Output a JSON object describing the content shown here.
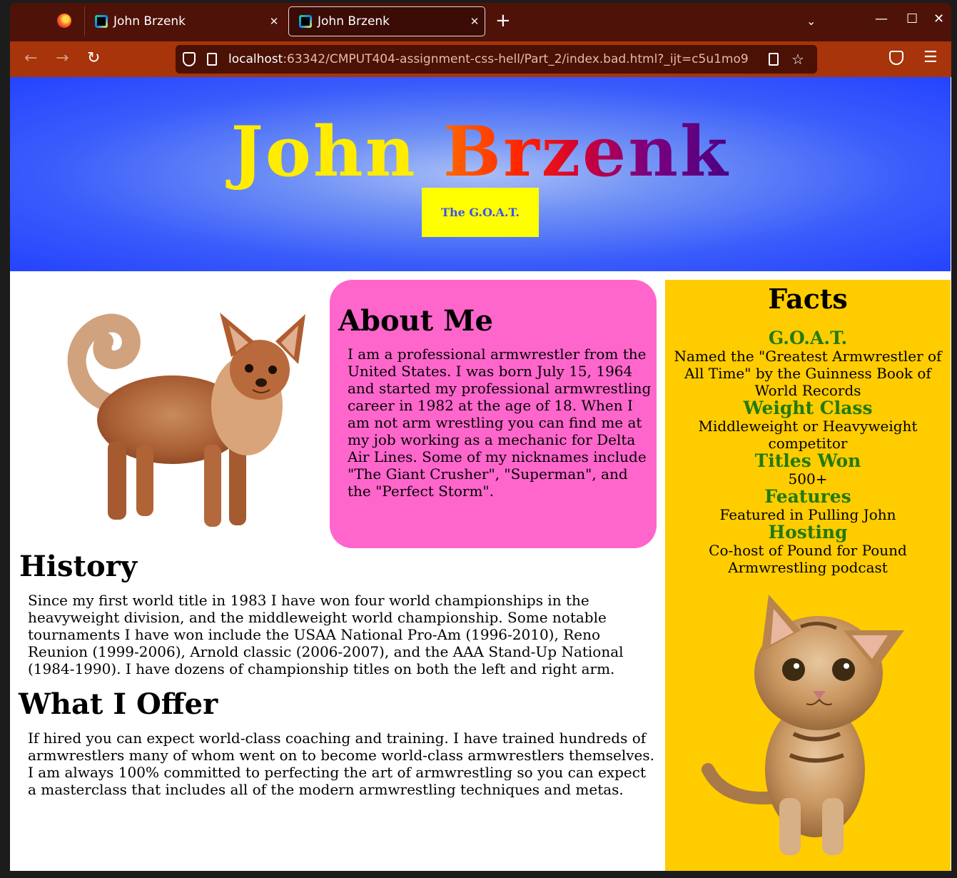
{
  "browser": {
    "tabs": [
      {
        "title": "John Brzenk"
      },
      {
        "title": "John Brzenk"
      }
    ],
    "new_tab_label": "+",
    "url_host": "localhost",
    "url_rest": ":63342/CMPUT404-assignment-css-hell/Part_2/index.bad.html?_ijt=c5u1mo9"
  },
  "page": {
    "hero": {
      "first_name": "John",
      "last_name": "Brzenk",
      "badge": "The G.O.A.T."
    },
    "about": {
      "title": "About Me",
      "text": "I am a professional armwrestler from the United States. I was born July 15, 1964 and started my professional armwrestling career in 1982 at the age of 18. When I am not arm wrestling you can find me at my job working as a mechanic for Delta Air Lines. Some of my nicknames include \"The Giant Crusher\", \"Superman\", and the \"Perfect Storm\"."
    },
    "history": {
      "title": "History",
      "text": "Since my first world title in 1983 I have won four world championships in the heavyweight division, and the middleweight world championship. Some notable tournaments I have won include the USAA National Pro-Am (1996-2010), Reno Reunion (1999-2006), Arnold classic (2006-2007), and the AAA Stand-Up National (1984-1990). I have dozens of championship titles on both the left and right arm."
    },
    "offer": {
      "title": "What I Offer",
      "text": "If hired you can expect world-class coaching and training. I have trained hundreds of armwrestlers many of whom went on to become world-class armwrestlers themselves. I am always 100% committed to perfecting the art of armwrestling so you can expect a masterclass that includes all of the modern armwrestling techniques and metas."
    },
    "facts": {
      "title": "Facts",
      "items": [
        {
          "heading": "G.O.A.T.",
          "text": "Named the \"Greatest Armwrestler of All Time\" by the Guinness Book of World Records"
        },
        {
          "heading": "Weight Class",
          "text": "Middleweight or Heavyweight competitor"
        },
        {
          "heading": "Titles Won",
          "text": "500+"
        },
        {
          "heading": "Features",
          "text": "Featured in Pulling John"
        },
        {
          "heading": "Hosting",
          "text": "Co-host of Pound for Pound Armwrestling podcast"
        }
      ]
    }
  },
  "colors": {
    "hero_blue": "#2443ff",
    "first_name": "#ffec00",
    "badge_bg": "#ffff00",
    "about_bg": "#ff66cc",
    "facts_bg": "#ffcc00",
    "fact_heading": "#237a0c"
  },
  "icons": [
    "firefox-logo-icon",
    "webstorm-icon",
    "close-icon",
    "chevron-down-icon",
    "minimize-icon",
    "maximize-icon",
    "window-close-icon",
    "back-arrow-icon",
    "forward-arrow-icon",
    "reload-icon",
    "shield-icon",
    "page-icon",
    "reader-view-icon",
    "star-icon",
    "pocket-icon",
    "hamburger-menu-icon"
  ]
}
